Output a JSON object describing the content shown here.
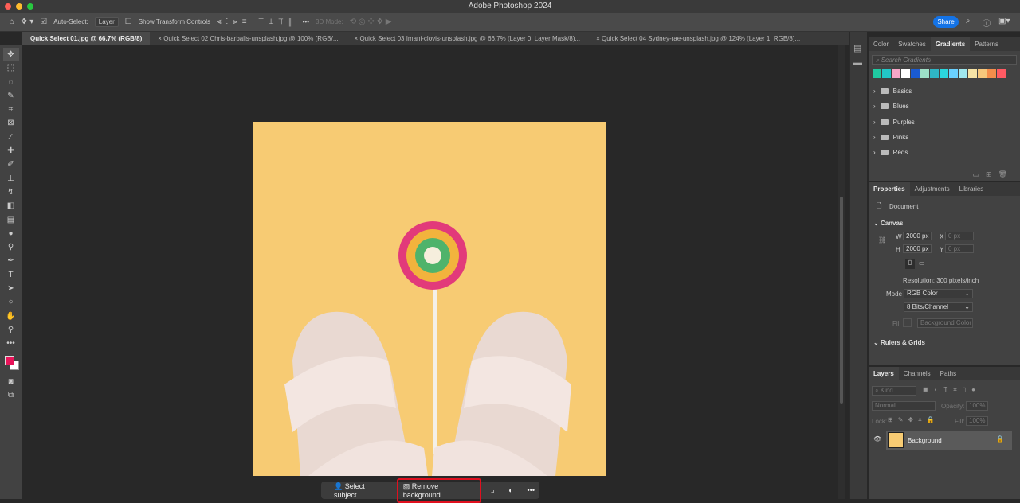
{
  "app": {
    "title": "Adobe Photoshop 2024"
  },
  "options": {
    "auto_select_label": "Auto-Select:",
    "auto_select_value": "Layer",
    "show_transform": "Show Transform Controls",
    "mode_3d": "3D Mode:",
    "more": "•••",
    "share": "Share"
  },
  "tabs": [
    {
      "label": "Quick Select 01.jpg @ 66.7% (RGB/8)"
    },
    {
      "label": "Quick Select 02 Chris-barbalis-unsplash.jpg @ 100% (RGB/..."
    },
    {
      "label": "Quick Select 03 Imani-clovis-unsplash.jpg @ 66.7% (Layer 0, Layer Mask/8)..."
    },
    {
      "label": "Quick Select 04 Sydney-rae-unsplash.jpg @ 124% (Layer 1, RGB/8)..."
    }
  ],
  "gradients": {
    "tabs": [
      "Color",
      "Swatches",
      "Gradients",
      "Patterns"
    ],
    "search_placeholder": "Search Gradients",
    "swatches": [
      "#1fc9a0",
      "#22c7c7",
      "#f7a7c8",
      "#ffffff",
      "#1a5bd1",
      "#9de0c8",
      "#2fb6c5",
      "#2bd6dd",
      "#6ad1ff",
      "#a0e8ef",
      "#f6e3a5",
      "#f6c77c",
      "#f48d4b",
      "#ff5a63"
    ],
    "folders": [
      "Basics",
      "Blues",
      "Purples",
      "Pinks",
      "Reds"
    ]
  },
  "properties": {
    "tabs": [
      "Properties",
      "Adjustments",
      "Libraries"
    ],
    "document": "Document",
    "canvas": "Canvas",
    "w_label": "W",
    "w": "2000 px",
    "h_label": "H",
    "h": "2000 px",
    "x_label": "X",
    "x": "0 px",
    "y_label": "Y",
    "y": "0 px",
    "resolution": "Resolution: 300 pixels/inch",
    "mode_label": "Mode",
    "mode": "RGB Color",
    "bits": "8 Bits/Channel",
    "fill_label": "Fill",
    "fill": "Background Color",
    "rulers": "Rulers & Grids"
  },
  "layers": {
    "tabs": [
      "Layers",
      "Channels",
      "Paths"
    ],
    "kind": "Kind",
    "blend": "Normal",
    "opacity_label": "Opacity:",
    "opacity": "100%",
    "lock_label": "Lock:",
    "fill_label": "Fill:",
    "fill": "100%",
    "items": [
      {
        "name": "Background"
      }
    ]
  },
  "context": {
    "select_subject": "Select subject",
    "remove_background": "Remove background",
    "more": "•••"
  },
  "colors": {
    "foreground": "#e8155a",
    "background": "#ffffff",
    "highlight": "#e0101f"
  }
}
